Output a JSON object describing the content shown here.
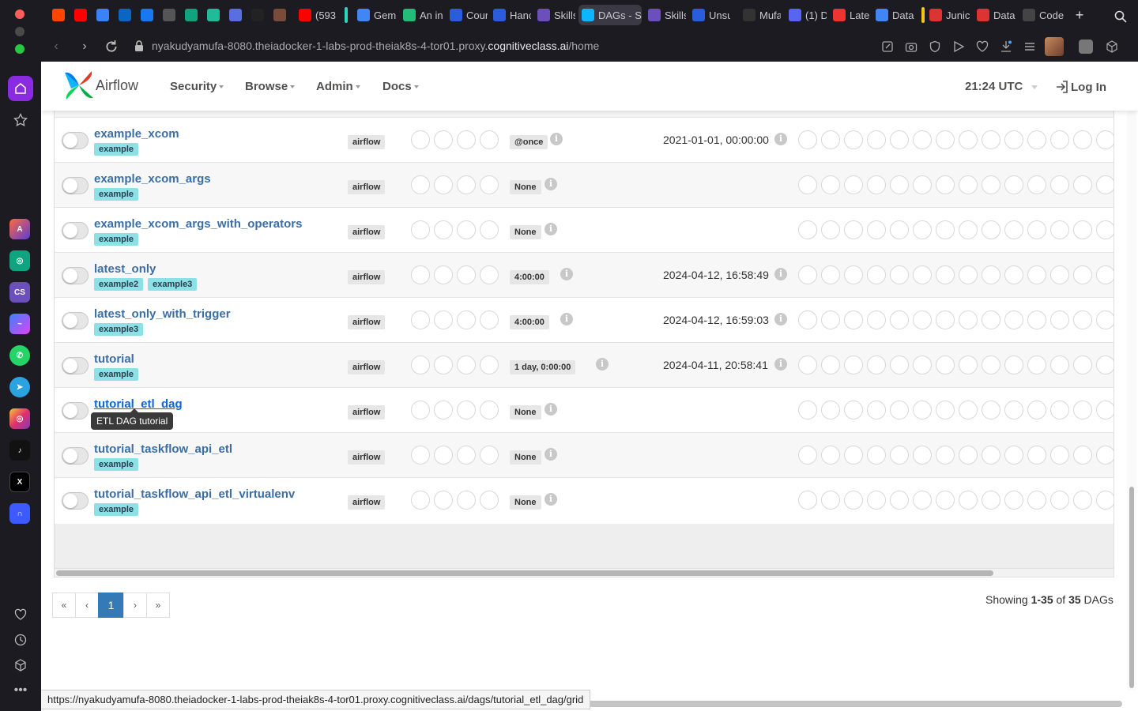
{
  "browser": {
    "tabs": [
      {
        "label": "",
        "color": "#ff4500"
      },
      {
        "label": "",
        "color": "#ff0000"
      },
      {
        "label": "",
        "color": "#3b82f6"
      },
      {
        "label": "",
        "color": "#0a66c2"
      },
      {
        "label": "",
        "color": "#1877f2"
      },
      {
        "label": "",
        "color": "#555"
      },
      {
        "label": "",
        "color": "#10a37f"
      },
      {
        "label": "",
        "color": "#2b9"
      },
      {
        "label": "",
        "color": "#5b6ee1"
      },
      {
        "label": "",
        "color": "#222"
      },
      {
        "label": "",
        "color": "#7a4a3a"
      },
      {
        "label": "(593",
        "color": "#ff0000"
      },
      {
        "label": "Gem",
        "color": "#4285f4"
      },
      {
        "label": "An in",
        "color": "#2b7"
      },
      {
        "label": "Cour",
        "color": "#2a5cdb"
      },
      {
        "label": "Hanc",
        "color": "#2a5cdb"
      },
      {
        "label": "Skills",
        "color": "#6b4fbb"
      },
      {
        "label": "DAGs - S",
        "color": "#0cb6ff"
      },
      {
        "label": "Skills",
        "color": "#6b4fbb"
      },
      {
        "label": "Unsu",
        "color": "#2a5cdb"
      },
      {
        "label": "Mufa",
        "color": "#333"
      },
      {
        "label": "(1) D",
        "color": "#5865f2"
      },
      {
        "label": "Late",
        "color": "#e33"
      },
      {
        "label": "Data",
        "color": "#4285f4"
      },
      {
        "label": "Junic",
        "color": "#d33"
      },
      {
        "label": "Data",
        "color": "#d33"
      },
      {
        "label": "Code",
        "color": "#444"
      }
    ],
    "url_host_prefix": "nyakudyamufa-8080.theiadocker-1-labs-prod-theiak8s-4-tor01.proxy.",
    "url_host_domain": "cognitiveclass.ai",
    "url_path": "/home",
    "status_url": "https://nyakudyamufa-8080.theiadocker-1-labs-prod-theiak8s-4-tor01.proxy.cognitiveclass.ai/dags/tutorial_etl_dag/grid"
  },
  "navbar": {
    "brand": "Airflow",
    "menus": [
      "Security",
      "Browse",
      "Admin",
      "Docs"
    ],
    "clock": "21:24 UTC",
    "login": "Log In"
  },
  "dags": [
    {
      "name": "example_xcom",
      "tags": [
        "example"
      ],
      "owner": "airflow",
      "schedule": "@once",
      "next_run": "2021-01-01, 00:00:00"
    },
    {
      "name": "example_xcom_args",
      "tags": [
        "example"
      ],
      "owner": "airflow",
      "schedule": "None",
      "next_run": ""
    },
    {
      "name": "example_xcom_args_with_operators",
      "tags": [
        "example"
      ],
      "owner": "airflow",
      "schedule": "None",
      "next_run": ""
    },
    {
      "name": "latest_only",
      "tags": [
        "example2",
        "example3"
      ],
      "owner": "airflow",
      "schedule": "4:00:00",
      "next_run": "2024-04-12, 16:58:49"
    },
    {
      "name": "latest_only_with_trigger",
      "tags": [
        "example3"
      ],
      "owner": "airflow",
      "schedule": "4:00:00",
      "next_run": "2024-04-12, 16:59:03"
    },
    {
      "name": "tutorial",
      "tags": [
        "example"
      ],
      "owner": "airflow",
      "schedule": "1 day, 0:00:00",
      "next_run": "2024-04-11, 20:58:41"
    },
    {
      "name": "tutorial_etl_dag",
      "tags": [],
      "owner": "airflow",
      "schedule": "None",
      "next_run": "",
      "tooltip": "ETL DAG tutorial",
      "hover": true
    },
    {
      "name": "tutorial_taskflow_api_etl",
      "tags": [
        "example"
      ],
      "owner": "airflow",
      "schedule": "None",
      "next_run": ""
    },
    {
      "name": "tutorial_taskflow_api_etl_virtualenv",
      "tags": [
        "example"
      ],
      "owner": "airflow",
      "schedule": "None",
      "next_run": ""
    }
  ],
  "pagination": {
    "first": "«",
    "prev": "‹",
    "current": "1",
    "next": "›",
    "last": "»",
    "showing_prefix": "Showing ",
    "showing_range": "1-35",
    "showing_mid": " of ",
    "showing_total": "35",
    "showing_suffix": " DAGs"
  },
  "colors": {
    "tag": "#8ce1e6",
    "link": "#3b6ea5",
    "page_active": "#337ab7",
    "sidebar_active": "#8a2be2"
  }
}
